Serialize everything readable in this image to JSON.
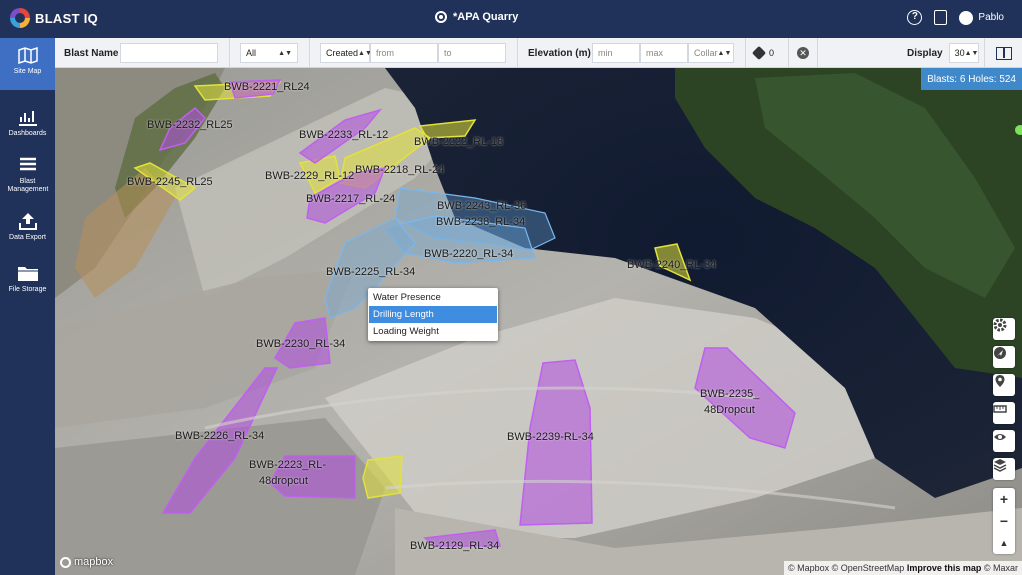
{
  "app": {
    "brand": "BLAST IQ",
    "site_name": "*APA Quarry",
    "user_name": "Pablo"
  },
  "icons": {
    "logo": "blast-iq-logo-icon",
    "site": "location-target-icon",
    "help": "help-icon",
    "notes": "document-icon",
    "user": "user-icon"
  },
  "sidebar": {
    "items": [
      {
        "label": "Site Map",
        "icon": "map-icon",
        "active": true
      },
      {
        "label": "Dashboards",
        "icon": "chart-icon",
        "active": false
      },
      {
        "label": "Blast Management",
        "icon": "list-icon",
        "active": false
      },
      {
        "label": "Data Export",
        "icon": "upload-icon",
        "active": false
      },
      {
        "label": "File Storage",
        "icon": "folder-icon",
        "active": false
      }
    ]
  },
  "filters": {
    "blast_name_label": "Blast Name",
    "blast_name_value": "",
    "status_select": "All",
    "date_type_select": "Created",
    "date_from_placeholder": "from",
    "date_to_placeholder": "to",
    "elevation_label": "Elevation (m)",
    "elevation_min_placeholder": "min",
    "elevation_max_placeholder": "max",
    "elevation_ref_select": "Collar",
    "tag_count": "0",
    "display_label": "Display",
    "display_select": "30"
  },
  "map": {
    "blast_count_text": "Blasts: 6 Holes: 524",
    "popup_items": [
      {
        "label": "Water Presence",
        "selected": false
      },
      {
        "label": "Drilling Length",
        "selected": true
      },
      {
        "label": "Loading Weight",
        "selected": false
      }
    ],
    "blast_labels": [
      "BWB-2221_RL24",
      "BWB-2232_RL25",
      "BWB-2233_RL-12",
      "BWB-2222_RL-18",
      "BWB-2245_RL25",
      "BWB-2229_RL-12",
      "BWB-2218_RL-24",
      "BWB-2217_RL-24",
      "BWB-2243_RL-36",
      "BWB-2238_RL-34",
      "BWB-2220_RL-34",
      "BWB-2225_RL-34",
      "BWB-2240_RL-34",
      "BWB-2230_RL-34",
      "BWB-2235_",
      "48Dropcut",
      "BWB-2226_RL-34",
      "BWB-2239-RL-34",
      "BWB-2223_RL-",
      "48dropcut",
      "BWB-2129_RL-34"
    ],
    "tools": [
      "settings-icon",
      "navigate-icon",
      "location-pin-icon",
      "measure-icon",
      "visibility-eye-icon",
      "layers-icon"
    ],
    "zoom_in": "+",
    "zoom_out": "−",
    "compass": "▲",
    "mapbox_logo": "mapbox",
    "attribution_mapbox": "© Mapbox",
    "attribution_osm": "© OpenStreetMap",
    "attribution_improve": "Improve this map",
    "attribution_maxar": "© Maxar"
  },
  "colors": {
    "header": "#20325a",
    "active_sidebar": "#3f6fc2",
    "purple_blast": "#b04de0",
    "yellow_blast": "#e2e23a",
    "blue_blast": "#6aa9e0",
    "selection": "#3e8de0"
  }
}
